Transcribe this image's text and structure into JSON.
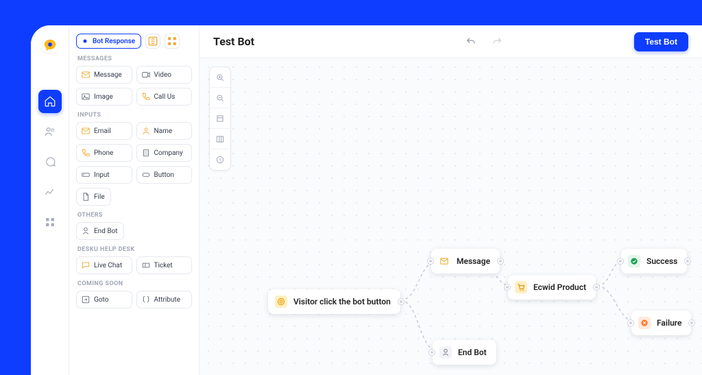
{
  "sidebar_tab_label": "Bot Response",
  "sections": {
    "messages": {
      "heading": "MESSAGES",
      "items": {
        "message": "Message",
        "video": "Video",
        "image": "Image",
        "callus": "Call Us"
      }
    },
    "inputs": {
      "heading": "INPUTS",
      "items": {
        "email": "Email",
        "name": "Name",
        "phone": "Phone",
        "company": "Company",
        "input": "Input",
        "button": "Button",
        "file": "File"
      }
    },
    "others": {
      "heading": "OTHERS",
      "items": {
        "endbot": "End Bot"
      }
    },
    "helpdesk": {
      "heading": "DESKU HELP DESK",
      "items": {
        "livechat": "Live Chat",
        "ticket": "Ticket"
      }
    },
    "coming": {
      "heading": "COMING SOON",
      "items": {
        "goto": "Goto",
        "attribute": "Attribute"
      }
    }
  },
  "header": {
    "title": "Test Bot",
    "cta": "Test Bot"
  },
  "nodes": {
    "start": "Visitor click the bot button",
    "message": "Message",
    "endbot": "End Bot",
    "ecwid": "Ecwid Product",
    "success": "Success",
    "failure": "Failure"
  }
}
